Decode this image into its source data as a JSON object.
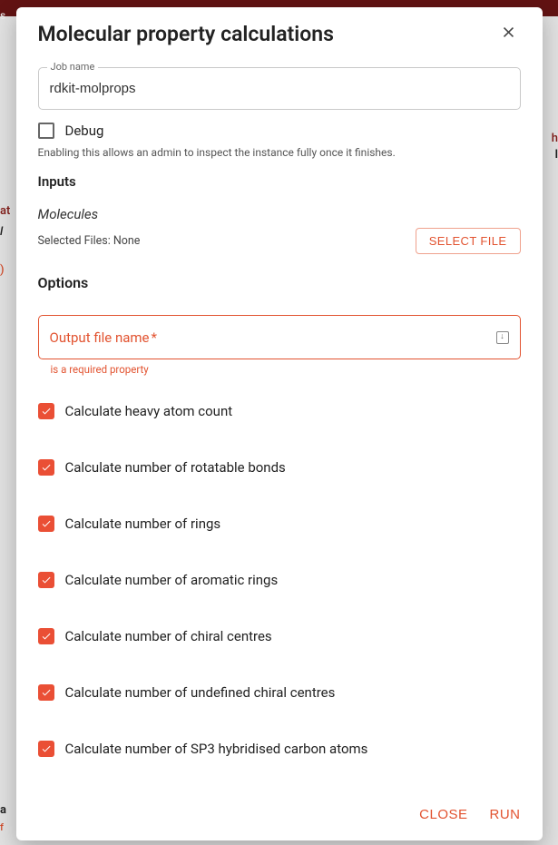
{
  "modal": {
    "title": "Molecular property calculations",
    "job_name_label": "Job name",
    "job_name_value": "rdkit-molprops",
    "debug_label": "Debug",
    "debug_help": "Enabling this allows an admin to inspect the instance fully once it finishes.",
    "inputs_header": "Inputs",
    "molecules_label": "Molecules",
    "selected_files_text": "Selected Files: None",
    "select_file_button": "SELECT FILE",
    "options_header": "Options",
    "output_field_label": "Output file name",
    "output_field_asterisk": "*",
    "output_field_error": "is a required property",
    "option_labels": [
      "Calculate heavy atom count",
      "Calculate number of rotatable bonds",
      "Calculate number of rings",
      "Calculate number of aromatic rings",
      "Calculate number of chiral centres",
      "Calculate number of undefined chiral centres",
      "Calculate number of SP3 hybridised carbon atoms"
    ],
    "footer": {
      "close": "CLOSE",
      "run": "RUN"
    }
  },
  "background_fragments": {
    "tl": "s",
    "right1": "h",
    "right2": "l",
    "left1": "at",
    "left2": "l",
    "left3": ")",
    "left4": "a",
    "left5": "f"
  }
}
